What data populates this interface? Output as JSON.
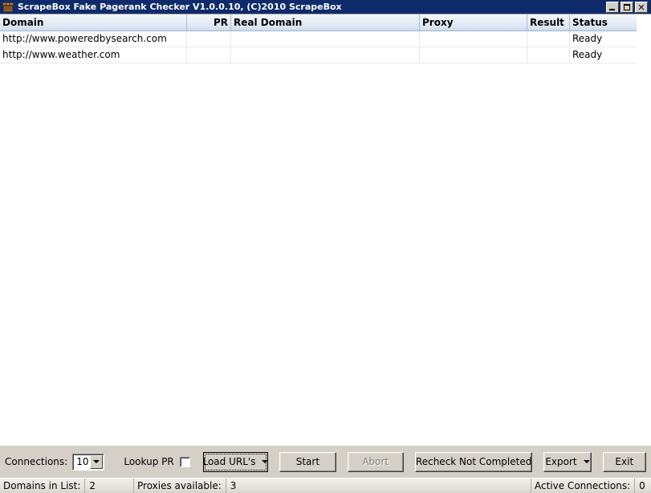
{
  "window": {
    "title": "ScrapeBox Fake Pagerank Checker V1.0.0.10, (C)2010 ScrapeBox",
    "icon": "box-icon",
    "controls": {
      "minimize": "minimize-icon",
      "maximize": "maximize-icon",
      "close": "✕"
    }
  },
  "grid": {
    "columns": [
      {
        "key": "domain",
        "label": "Domain"
      },
      {
        "key": "pr",
        "label": "PR"
      },
      {
        "key": "real_domain",
        "label": "Real Domain"
      },
      {
        "key": "proxy",
        "label": "Proxy"
      },
      {
        "key": "result",
        "label": "Result"
      },
      {
        "key": "status",
        "label": "Status"
      }
    ],
    "rows": [
      {
        "domain": "http://www.poweredbysearch.com",
        "pr": "",
        "real_domain": "",
        "proxy": "",
        "result": "",
        "status": "Ready"
      },
      {
        "domain": "http://www.weather.com",
        "pr": "",
        "real_domain": "",
        "proxy": "",
        "result": "",
        "status": "Ready"
      }
    ]
  },
  "toolbar": {
    "connections_label": "Connections:",
    "connections_value": "10",
    "connections_arrow_icon": "chevron-down-icon",
    "lookup_pr_label": "Lookup PR",
    "lookup_pr_checked": false,
    "load_urls_label": "Load URL's",
    "load_urls_arrow_icon": "chevron-down-icon",
    "start_label": "Start",
    "abort_label": "Abort",
    "abort_disabled": true,
    "recheck_label": "Recheck Not Completed",
    "export_label": "Export",
    "export_arrow_icon": "chevron-down-icon",
    "exit_label": "Exit"
  },
  "status_bar": {
    "domains_label": "Domains in List:",
    "domains_value": "2",
    "proxies_label": "Proxies available:",
    "proxies_value": "3",
    "active_label": "Active Connections:",
    "active_value": "0"
  },
  "colors": {
    "titlebar": "#0d2b6b",
    "chrome": "#d4d0c8",
    "header_gradient_top": "#f4f7fc",
    "header_gradient_bottom": "#ccd9ec",
    "grid_line": "#e4e9f2"
  }
}
